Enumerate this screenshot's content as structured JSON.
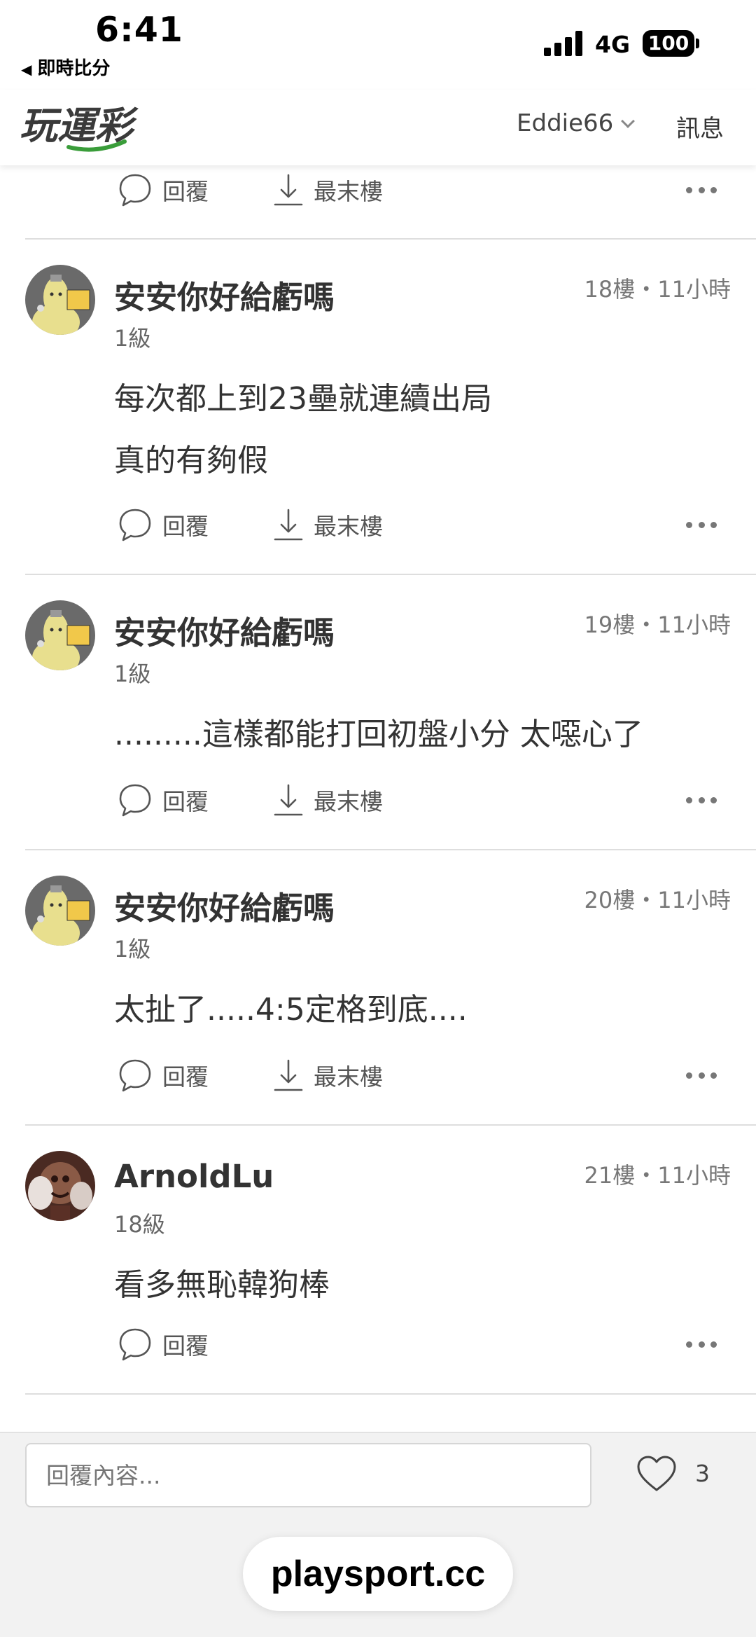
{
  "status_bar": {
    "time": "6:41",
    "back_app": "即時比分",
    "network": "4G",
    "battery": "100"
  },
  "nav": {
    "logo_text": "玩運彩",
    "username": "Eddie66",
    "messages": "訊息"
  },
  "actions": {
    "reply": "回覆",
    "last_floor": "最末樓"
  },
  "posts": [
    {
      "username": "安安你好給虧嗎",
      "meta": "18樓・11小時",
      "level": "1級",
      "lines": [
        "每次都上到23壘就連續出局",
        "真的有夠假"
      ]
    },
    {
      "username": "安安你好給虧嗎",
      "meta": "19樓・11小時",
      "level": "1級",
      "lines": [
        ".........這樣都能打回初盤小分 太噁心了"
      ]
    },
    {
      "username": "安安你好給虧嗎",
      "meta": "20樓・11小時",
      "level": "1級",
      "lines": [
        "太扯了.....4:5定格到底...."
      ]
    },
    {
      "username": "ArnoldLu",
      "meta": "21樓・11小時",
      "level": "18級",
      "lines": [
        "看多無恥韓狗棒"
      ]
    }
  ],
  "bottom": {
    "reply_placeholder": "回覆內容...",
    "like_count": "3",
    "url": "playsport.cc"
  },
  "colors": {
    "logo_green": "#3a9d3a",
    "text_main": "#333333",
    "text_muted": "#777777"
  }
}
